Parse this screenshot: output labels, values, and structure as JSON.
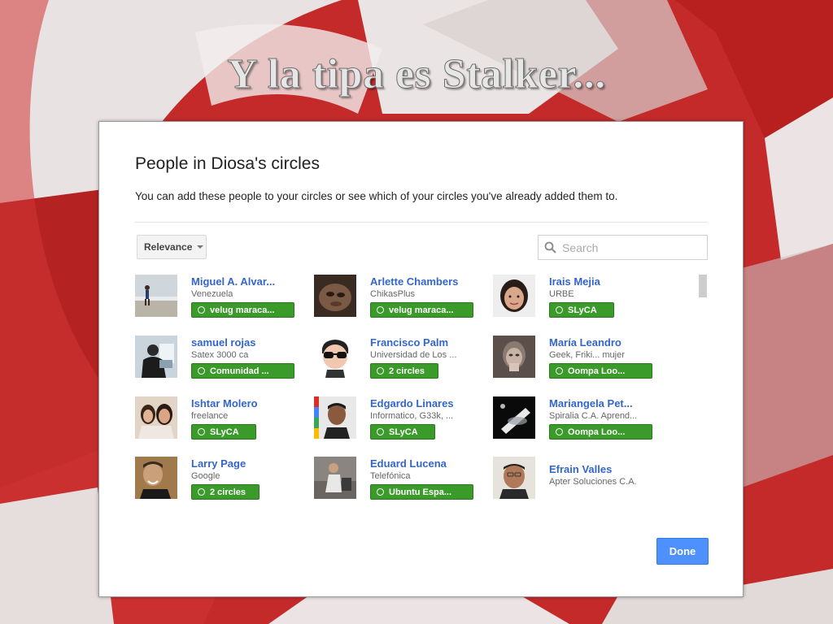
{
  "slide": {
    "title": "Y la tipa es Stalker..."
  },
  "dialog": {
    "title": "People in Diosa's circles",
    "description": "You can add these people to your circles or see which of your circles you've already added them to.",
    "sort_label": "Relevance",
    "search_placeholder": "Search",
    "done_label": "Done"
  },
  "people": [
    {
      "name": "Miguel A. Alvar...",
      "info": "Venezuela",
      "circle": "velug maraca..."
    },
    {
      "name": "Arlette Chambers",
      "info": "ChikasPlus",
      "circle": "velug maraca..."
    },
    {
      "name": "Irais Mejia",
      "info": "URBE",
      "circle": "SLyCA"
    },
    {
      "name": "samuel rojas",
      "info": "Satex 3000 ca",
      "circle": "Comunidad ..."
    },
    {
      "name": "Francisco Palm",
      "info": "Universidad de Los ...",
      "circle": "2 circles"
    },
    {
      "name": "María Leandro",
      "info": "Geek, Friki... mujer",
      "circle": "Oompa Loo..."
    },
    {
      "name": "Ishtar Molero",
      "info": "freelance",
      "circle": "SLyCA"
    },
    {
      "name": "Edgardo Linares",
      "info": "Informatico, G33k, ...",
      "circle": "SLyCA"
    },
    {
      "name": "Mariangela Pet...",
      "info": "Spiralia C.A. Aprend...",
      "circle": "Oompa Loo..."
    },
    {
      "name": "Larry Page",
      "info": "Google",
      "circle": "2 circles"
    },
    {
      "name": "Eduard Lucena",
      "info": "Telefónica",
      "circle": "Ubuntu Espa..."
    },
    {
      "name": "Efrain Valles",
      "info": "Apter Soluciones C.A.",
      "circle": ""
    }
  ],
  "colors": {
    "link_blue": "#3366cc",
    "circle_green": "#3a9a2a",
    "done_blue": "#4d90fe",
    "background_red": "#c8282a"
  }
}
